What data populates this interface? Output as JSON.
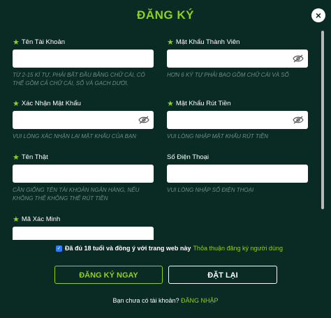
{
  "header": {
    "title": "ĐĂNG KÝ",
    "close_label": "×"
  },
  "fields": {
    "username": {
      "label": "Tên Tài Khoản",
      "value": "",
      "hint": "Từ 2-15 kí tự, phải bắt đầu bằng chữ cái, có thể gồm cả chữ cái, số và gạch dưới."
    },
    "password": {
      "label": "Mật Khẩu Thành Viên",
      "value": "",
      "hint": "Hơn 6 ký tự phải bao gồm chữ cái và số"
    },
    "confirm_password": {
      "label": "Xác Nhận Mật Khẩu",
      "value": "",
      "hint": "Vui lòng xác nhận lại mật khẩu của bạn"
    },
    "withdraw_password": {
      "label": "Mật Khẩu Rút Tiền",
      "value": "",
      "hint": "Vui lòng nhập mật khẩu rút tiền"
    },
    "real_name": {
      "label": "Tên Thật",
      "value": "",
      "hint": "Cần giống tên tài khoản ngân hàng, nếu không thể không thể rút tiền"
    },
    "phone": {
      "label": "Số Điện Thoại",
      "value": "",
      "hint": "Vui lòng nhập số điện thoại"
    },
    "captcha": {
      "label": "Mã Xác Minh",
      "value": ""
    }
  },
  "agreement": {
    "checked": true,
    "text": "Đã đủ 18 tuổi và đồng ý với trang web này",
    "link": "Thỏa thuận đăng ký người dùng"
  },
  "buttons": {
    "register": "ĐĂNG KÝ NGAY",
    "reset": "ĐẶT LẠI"
  },
  "footer": {
    "text": "Bạn chưa có tài khoản?",
    "link": "ĐĂNG NHẬP"
  },
  "colors": {
    "background": "#0a2a24",
    "accent": "#8fd11f",
    "hint": "#6f8d86"
  }
}
